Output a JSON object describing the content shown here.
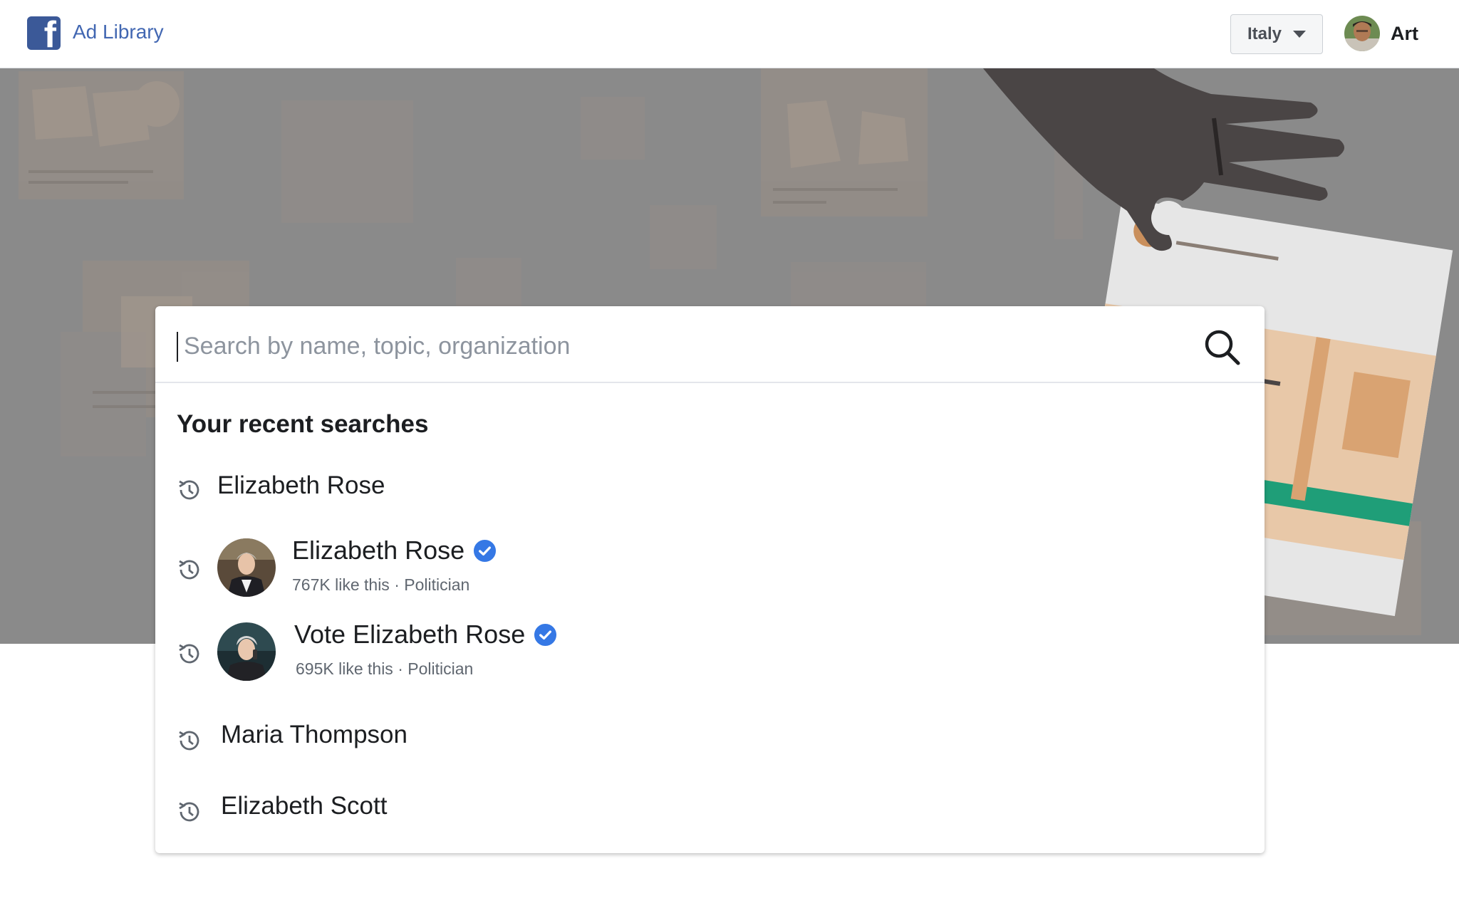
{
  "header": {
    "brand_label": "Ad Library",
    "country_label": "Italy",
    "user_name": "Art"
  },
  "search": {
    "placeholder": "Search by name, topic, organization",
    "value": ""
  },
  "recent": {
    "title": "Your recent searches",
    "items": [
      {
        "type": "query",
        "label": "Elizabeth Rose"
      },
      {
        "type": "page",
        "label": "Elizabeth Rose",
        "meta": "767K like this · Politician",
        "verified": true
      },
      {
        "type": "page",
        "label": "Vote Elizabeth Rose",
        "meta": "695K like this · Politician",
        "verified": true
      },
      {
        "type": "query",
        "label": "Maria Thompson"
      },
      {
        "type": "query",
        "label": "Elizabeth Scott"
      }
    ]
  },
  "colors": {
    "brand_blue": "#3b5998",
    "link_blue": "#4267b2",
    "verified_blue": "#3578e5",
    "hero_gray": "#8a8a8a",
    "accent_green": "#1f9e78"
  },
  "icons": {
    "logo": "facebook-logo-icon",
    "country_caret": "caret-down-icon",
    "search": "search-icon",
    "history": "history-clock-icon",
    "verified": "verified-badge-icon"
  }
}
